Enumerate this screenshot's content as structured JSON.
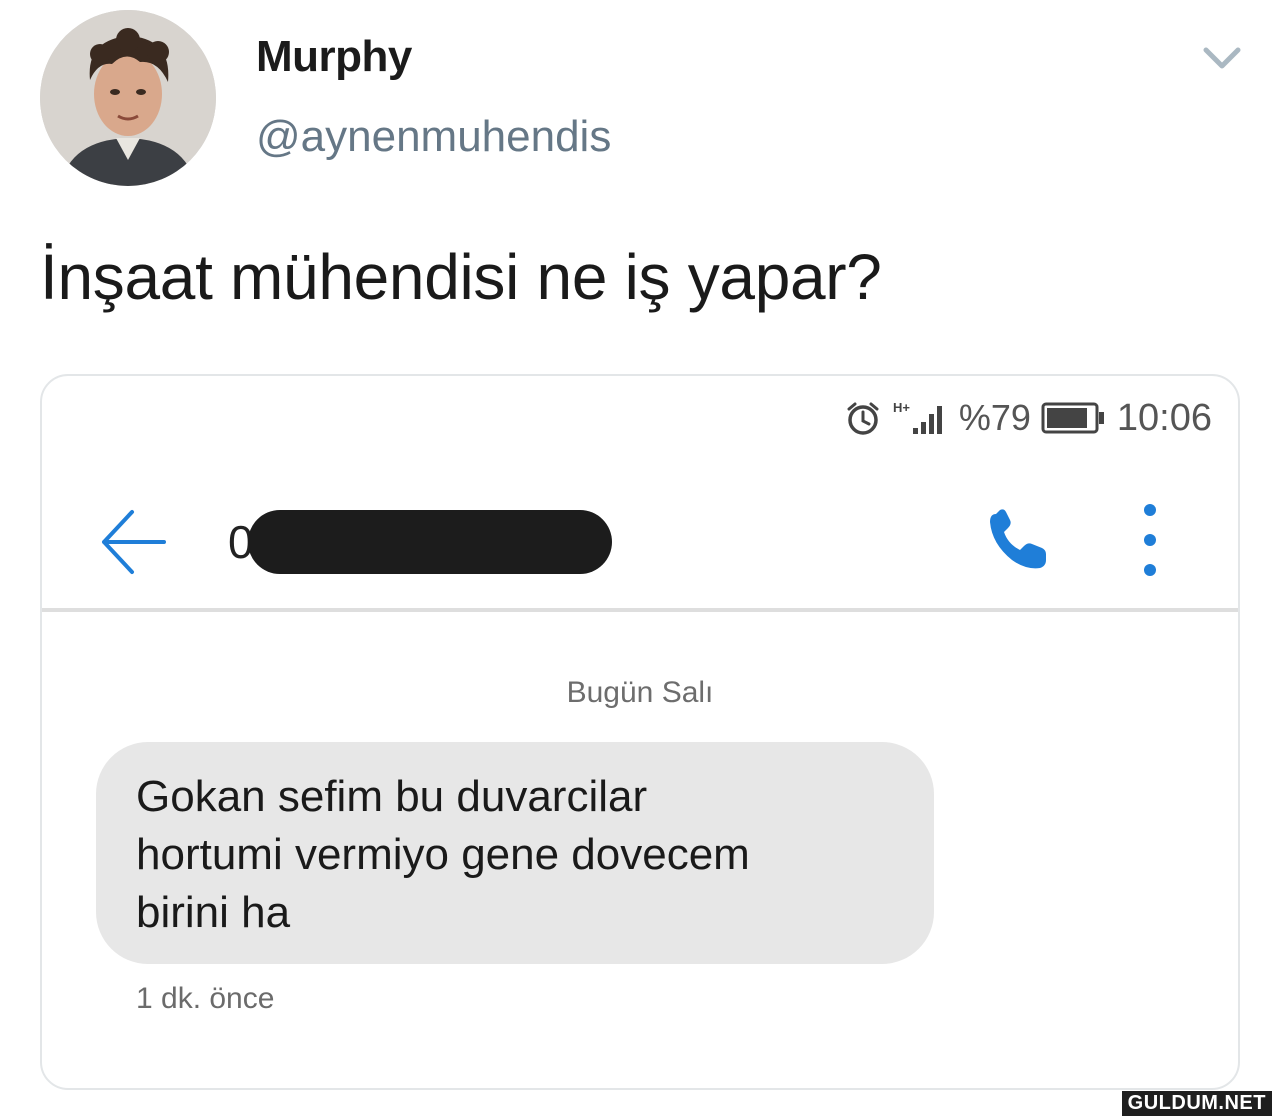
{
  "tweet": {
    "author": {
      "display_name": "Murphy",
      "handle": "@aynenmuhendis",
      "avatar_icon": "user-photo"
    },
    "menu_icon": "chevron-down-icon",
    "text": "İnşaat mühendisi ne iş yapar?"
  },
  "screenshot": {
    "status_bar": {
      "alarm_icon": "alarm-icon",
      "network_label": "H+",
      "signal_icon": "signal-bars-icon",
      "battery_percent": "%79",
      "battery_icon": "battery-icon",
      "time": "10:06"
    },
    "header": {
      "back_icon": "back-arrow-icon",
      "contact_prefix": "0",
      "call_icon": "phone-icon",
      "more_icon": "more-vert-icon",
      "accent_color": "#1f7ed8"
    },
    "conversation": {
      "date_label": "Bugün Salı",
      "messages": [
        {
          "lines": [
            "Gokan sefim bu duvarcilar",
            "hortumi vermiyo gene dovecem",
            "birini ha"
          ],
          "time": "1 dk. önce"
        }
      ]
    }
  },
  "watermark": "GULDUM.NET"
}
